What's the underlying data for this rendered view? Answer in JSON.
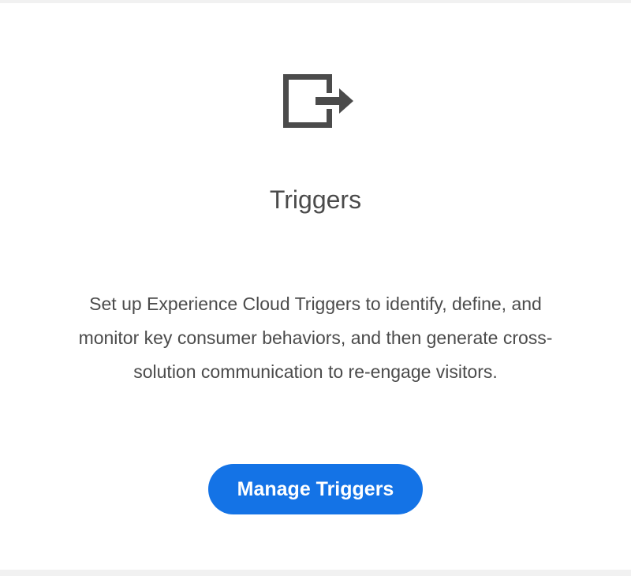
{
  "card": {
    "icon": "exit-arrow-icon",
    "title": "Triggers",
    "description": "Set up Experience Cloud Triggers to identify, define, and monitor key consumer behaviors, and then generate cross-solution communication to re-engage visitors.",
    "button_label": "Manage Triggers"
  },
  "colors": {
    "page_background": "#f1f1f1",
    "card_background": "#ffffff",
    "icon": "#4b4b4b",
    "text": "#4b4b4b",
    "button": "#1473e6",
    "button_text": "#ffffff"
  }
}
